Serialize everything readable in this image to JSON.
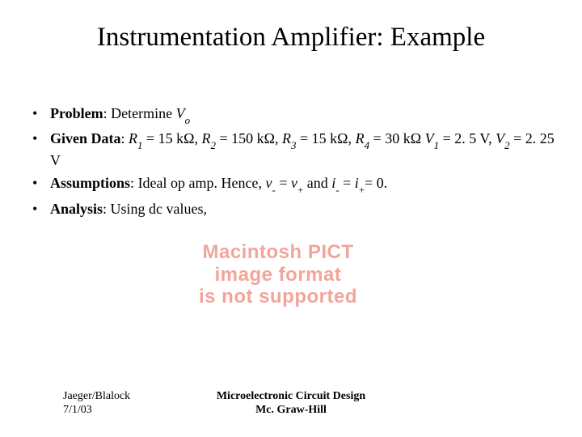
{
  "title": "Instrumentation Amplifier: Example",
  "bullets": {
    "problem": {
      "label": "Problem",
      "sep": ":  ",
      "pre": "Determine ",
      "var": "V",
      "sub": "o"
    },
    "given": {
      "label": "Given Data",
      "sep": ":  ",
      "r1v": "R",
      "r1s": "1",
      "r1e": " = 15 kΩ, ",
      "r2v": "R",
      "r2s": "2",
      "r2e": " = 150 kΩ, ",
      "r3v": "R",
      "r3s": "3",
      "r3e": " = 15 kΩ, ",
      "r4v": "R",
      "r4s": "4",
      "r4e": " = 30 kΩ ",
      "v1v": "V",
      "v1s": "1",
      "v1e": " = 2. 5 V, ",
      "v2v": "V",
      "v2s": "2",
      "v2e": " = 2. 25 V"
    },
    "assumptions": {
      "label": "Assumptions",
      "sep": ":  ",
      "pre": "Ideal op amp. Hence, ",
      "vnv": "v",
      "vns": "-",
      "eq1": " = ",
      "vpv": "v",
      "vps": "+",
      "and": " and ",
      "inv": "i",
      "ins": "-",
      "eq2": " = ",
      "ipv": "i",
      "ips": "+",
      "tail": "= 0."
    },
    "analysis": {
      "label": "Analysis",
      "sep": ":  ",
      "text": "Using dc values,"
    }
  },
  "pict": {
    "l1": "Macintosh PICT",
    "l2": "image format",
    "l3": "is not supported"
  },
  "footer": {
    "left1": "Jaeger/Blalock",
    "left2": "7/1/03",
    "center1": "Microelectronic Circuit Design",
    "center2": "Mc. Graw-Hill"
  }
}
